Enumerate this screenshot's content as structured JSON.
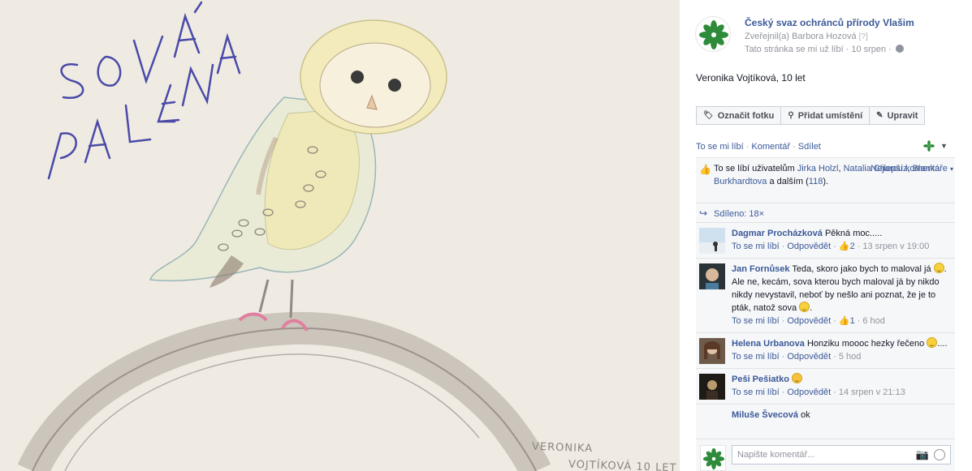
{
  "photo": {
    "handwriting": [
      "SOVA",
      "PÁLENÁ"
    ],
    "signature": [
      "VERONIKA",
      "VOJTÍKOVÁ 10 LET"
    ]
  },
  "page": {
    "name": "Český svaz ochránců přírody Vlašim",
    "published_prefix": "Zveřejnil(a) ",
    "published_by": "Barbora Hozová",
    "published_hint": "[?]",
    "liked_status": "Tato stránka se mi už líbí",
    "date": "10 srpen"
  },
  "caption": "Veronika Vojtíková, 10 let",
  "actions": {
    "tag": "Označit fotku",
    "location": "Přidat umístění",
    "edit": "Upravit"
  },
  "likebar": {
    "like": "To se mi líbí",
    "comment": "Komentář",
    "share": "Sdílet"
  },
  "feedback": {
    "likes_prefix": "To se líbí uživatelům ",
    "liker1": "Jirka Holzl",
    "liker2": "Natalia Charouz",
    "liker3": "Blanka Burkhardtova",
    "likes_and": " a dalším (",
    "likes_count": "118",
    "likes_end": ").",
    "best_comments": "Nejlepší komentáře",
    "shares": "Sdíleno: 18×"
  },
  "comments": [
    {
      "name": "Dagmar Procházková",
      "text": "Pěkná moc.....",
      "like": "To se mi líbí",
      "reply": "Odpovědět",
      "likes": "2",
      "time": "13 srpen v 19:00"
    },
    {
      "name": "Jan Fornůsek",
      "text": "Teda, skoro jako bych to maloval já",
      "text2": ". Ale ne, kecám, sova kterou bych maloval já by nikdo nikdy nevystavil, neboť by nešlo ani poznat, že je to pták, natož sova",
      "text3": ".",
      "like": "To se mi líbí",
      "reply": "Odpovědět",
      "likes": "1",
      "time": "6 hod"
    },
    {
      "name": "Helena Urbanova",
      "text": "Honziku moooc hezky řečeno",
      "text2": "....",
      "like": "To se mi líbí",
      "reply": "Odpovědět",
      "time": "5 hod"
    },
    {
      "name": "Peši Pešiatko",
      "like": "To se mi líbí",
      "reply": "Odpovědět",
      "time": "14 srpen v 21:13"
    },
    {
      "name": "Miluše Švecová",
      "text": "ok"
    }
  ],
  "composer": {
    "placeholder": "Napište komentář..."
  },
  "colors": {
    "link": "#3b5998",
    "paper": "#efebe3",
    "ink": "#4a4aa8",
    "logo_green": "#2e8b3a"
  }
}
